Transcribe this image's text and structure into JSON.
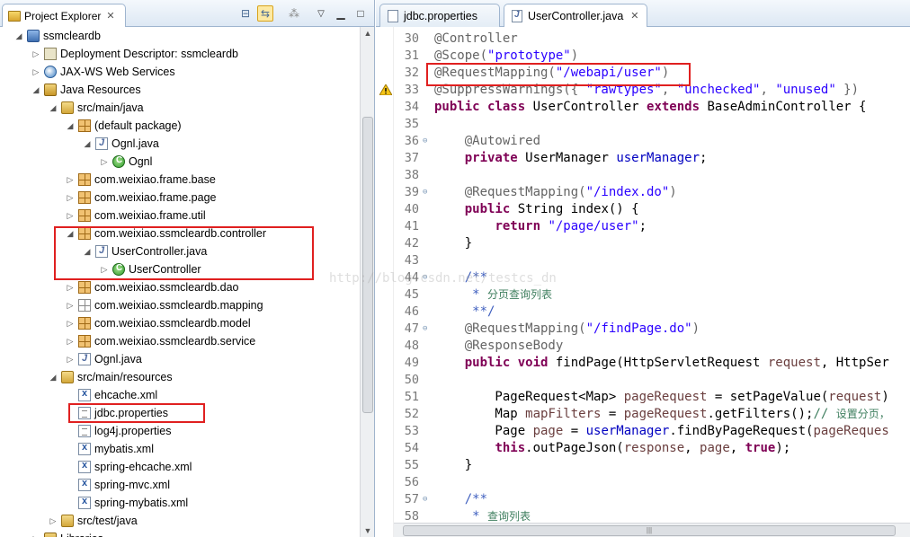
{
  "explorer": {
    "tab_label": "Project Explorer",
    "tree": [
      {
        "label": "ssmcleardb",
        "icon": "project",
        "indent": 0,
        "twisty": "open"
      },
      {
        "label": "Deployment Descriptor: ssmcleardb",
        "icon": "dd",
        "indent": 1,
        "twisty": "closed"
      },
      {
        "label": "JAX-WS Web Services",
        "icon": "ws",
        "indent": 1,
        "twisty": "closed"
      },
      {
        "label": "Java Resources",
        "icon": "jr",
        "indent": 1,
        "twisty": "open"
      },
      {
        "label": "src/main/java",
        "icon": "srcfolder",
        "indent": 2,
        "twisty": "open"
      },
      {
        "label": "(default package)",
        "icon": "pkg",
        "indent": 3,
        "twisty": "open"
      },
      {
        "label": "Ognl.java",
        "icon": "jfile",
        "indent": 4,
        "twisty": "open"
      },
      {
        "label": "Ognl",
        "icon": "cls",
        "indent": 5,
        "twisty": "closed"
      },
      {
        "label": "com.weixiao.frame.base",
        "icon": "pkg",
        "indent": 3,
        "twisty": "closed"
      },
      {
        "label": "com.weixiao.frame.page",
        "icon": "pkg",
        "indent": 3,
        "twisty": "closed"
      },
      {
        "label": "com.weixiao.frame.util",
        "icon": "pkg",
        "indent": 3,
        "twisty": "closed"
      },
      {
        "label": "com.weixiao.ssmcleardb.controller",
        "icon": "pkg",
        "indent": 3,
        "twisty": "open"
      },
      {
        "label": "UserController.java",
        "icon": "jfile",
        "indent": 4,
        "twisty": "open"
      },
      {
        "label": "UserController",
        "icon": "cls",
        "indent": 5,
        "twisty": "closed"
      },
      {
        "label": "com.weixiao.ssmcleardb.dao",
        "icon": "pkg",
        "indent": 3,
        "twisty": "closed"
      },
      {
        "label": "com.weixiao.ssmcleardb.mapping",
        "icon": "pkg-empty",
        "indent": 3,
        "twisty": "closed"
      },
      {
        "label": "com.weixiao.ssmcleardb.model",
        "icon": "pkg",
        "indent": 3,
        "twisty": "closed"
      },
      {
        "label": "com.weixiao.ssmcleardb.service",
        "icon": "pkg",
        "indent": 3,
        "twisty": "closed"
      },
      {
        "label": "Ognl.java",
        "icon": "jfile",
        "indent": 3,
        "twisty": "closed"
      },
      {
        "label": "src/main/resources",
        "icon": "srcfolder",
        "indent": 2,
        "twisty": "open"
      },
      {
        "label": "ehcache.xml",
        "icon": "xml",
        "indent": 3,
        "twisty": "none"
      },
      {
        "label": "jdbc.properties",
        "icon": "props",
        "indent": 3,
        "twisty": "none"
      },
      {
        "label": "log4j.properties",
        "icon": "props",
        "indent": 3,
        "twisty": "none"
      },
      {
        "label": "mybatis.xml",
        "icon": "xml",
        "indent": 3,
        "twisty": "none"
      },
      {
        "label": "spring-ehcache.xml",
        "icon": "xml",
        "indent": 3,
        "twisty": "none"
      },
      {
        "label": "spring-mvc.xml",
        "icon": "xml",
        "indent": 3,
        "twisty": "none"
      },
      {
        "label": "spring-mybatis.xml",
        "icon": "xml",
        "indent": 3,
        "twisty": "none"
      },
      {
        "label": "src/test/java",
        "icon": "srcfolder",
        "indent": 2,
        "twisty": "closed"
      },
      {
        "label": "Libraries",
        "icon": "jr",
        "indent": 1,
        "twisty": "closed"
      }
    ]
  },
  "editor": {
    "tabs": [
      {
        "label": "jdbc.properties",
        "active": false
      },
      {
        "label": "UserController.java",
        "active": true
      }
    ],
    "lines": [
      {
        "n": "30",
        "fold": "",
        "warn": false,
        "tokens": [
          [
            "ann",
            "@Controller"
          ]
        ]
      },
      {
        "n": "31",
        "fold": "",
        "warn": false,
        "tokens": [
          [
            "ann",
            "@Scope("
          ],
          [
            "str",
            "\"prototype\""
          ],
          [
            "ann",
            ")"
          ]
        ]
      },
      {
        "n": "32",
        "fold": "",
        "warn": false,
        "tokens": [
          [
            "ann",
            "@RequestMapping("
          ],
          [
            "str",
            "\"/webapi/user\""
          ],
          [
            "ann",
            ")"
          ]
        ]
      },
      {
        "n": "33",
        "fold": "",
        "warn": true,
        "tokens": [
          [
            "ann",
            "@SuppressWarnings({ "
          ],
          [
            "str",
            "\"rawtypes\""
          ],
          [
            "ann",
            ", "
          ],
          [
            "str",
            "\"unchecked\""
          ],
          [
            "ann",
            ", "
          ],
          [
            "str",
            "\"unused\""
          ],
          [
            "ann",
            " })"
          ]
        ]
      },
      {
        "n": "34",
        "fold": "",
        "warn": false,
        "tokens": [
          [
            "kw",
            "public class"
          ],
          [
            "ctext",
            " UserController "
          ],
          [
            "kw",
            "extends"
          ],
          [
            "ctext",
            " BaseAdminController {"
          ]
        ]
      },
      {
        "n": "35",
        "fold": "",
        "warn": false,
        "tokens": []
      },
      {
        "n": "36",
        "fold": "⊖",
        "warn": false,
        "tokens": [
          [
            "ctext",
            "    "
          ],
          [
            "ann",
            "@Autowired"
          ]
        ]
      },
      {
        "n": "37",
        "fold": "",
        "warn": false,
        "tokens": [
          [
            "ctext",
            "    "
          ],
          [
            "kw",
            "private"
          ],
          [
            "ctext",
            " UserManager "
          ],
          [
            "fld",
            "userManager"
          ],
          [
            "ctext",
            ";"
          ]
        ]
      },
      {
        "n": "38",
        "fold": "",
        "warn": false,
        "tokens": []
      },
      {
        "n": "39",
        "fold": "⊖",
        "warn": false,
        "tokens": [
          [
            "ctext",
            "    "
          ],
          [
            "ann",
            "@RequestMapping("
          ],
          [
            "str",
            "\"/index.do\""
          ],
          [
            "ann",
            ")"
          ]
        ]
      },
      {
        "n": "40",
        "fold": "",
        "warn": false,
        "tokens": [
          [
            "ctext",
            "    "
          ],
          [
            "kw",
            "public"
          ],
          [
            "ctext",
            " String index() {"
          ]
        ]
      },
      {
        "n": "41",
        "fold": "",
        "warn": false,
        "tokens": [
          [
            "ctext",
            "        "
          ],
          [
            "kw",
            "return"
          ],
          [
            "ctext",
            " "
          ],
          [
            "str",
            "\"/page/user\""
          ],
          [
            "ctext",
            ";"
          ]
        ]
      },
      {
        "n": "42",
        "fold": "",
        "warn": false,
        "tokens": [
          [
            "ctext",
            "    }"
          ]
        ]
      },
      {
        "n": "43",
        "fold": "",
        "warn": false,
        "tokens": []
      },
      {
        "n": "44",
        "fold": "⊖",
        "warn": false,
        "tokens": [
          [
            "ctext",
            "    "
          ],
          [
            "jdoc",
            "/**"
          ]
        ]
      },
      {
        "n": "45",
        "fold": "",
        "warn": false,
        "tokens": [
          [
            "ctext",
            "     "
          ],
          [
            "jdoc",
            "* "
          ],
          [
            "cn",
            "分页查询列表"
          ]
        ]
      },
      {
        "n": "46",
        "fold": "",
        "warn": false,
        "tokens": [
          [
            "ctext",
            "     "
          ],
          [
            "jdoc",
            "**/"
          ]
        ]
      },
      {
        "n": "47",
        "fold": "⊖",
        "warn": false,
        "tokens": [
          [
            "ctext",
            "    "
          ],
          [
            "ann",
            "@RequestMapping("
          ],
          [
            "str",
            "\"/findPage.do\""
          ],
          [
            "ann",
            ")"
          ]
        ]
      },
      {
        "n": "48",
        "fold": "",
        "warn": false,
        "tokens": [
          [
            "ctext",
            "    "
          ],
          [
            "ann",
            "@ResponseBody"
          ]
        ]
      },
      {
        "n": "49",
        "fold": "",
        "warn": false,
        "tokens": [
          [
            "ctext",
            "    "
          ],
          [
            "kw",
            "public void"
          ],
          [
            "ctext",
            " findPage(HttpServletRequest "
          ],
          [
            "var",
            "request"
          ],
          [
            "ctext",
            ", HttpSer"
          ]
        ]
      },
      {
        "n": "50",
        "fold": "",
        "warn": false,
        "tokens": []
      },
      {
        "n": "51",
        "fold": "",
        "warn": false,
        "tokens": [
          [
            "ctext",
            "        PageRequest<Map> "
          ],
          [
            "var",
            "pageRequest"
          ],
          [
            "ctext",
            " = setPageValue("
          ],
          [
            "var",
            "request"
          ],
          [
            "ctext",
            ")"
          ]
        ]
      },
      {
        "n": "52",
        "fold": "",
        "warn": false,
        "tokens": [
          [
            "ctext",
            "        Map "
          ],
          [
            "var",
            "mapFilters"
          ],
          [
            "ctext",
            " = "
          ],
          [
            "var",
            "pageRequest"
          ],
          [
            "ctext",
            ".getFilters();"
          ],
          [
            "cmt",
            "// "
          ],
          [
            "cn",
            "设置分页，"
          ]
        ]
      },
      {
        "n": "53",
        "fold": "",
        "warn": false,
        "tokens": [
          [
            "ctext",
            "        Page "
          ],
          [
            "var",
            "page"
          ],
          [
            "ctext",
            " = "
          ],
          [
            "fld",
            "userManager"
          ],
          [
            "ctext",
            ".findByPageRequest("
          ],
          [
            "var",
            "pageReques"
          ]
        ]
      },
      {
        "n": "54",
        "fold": "",
        "warn": false,
        "tokens": [
          [
            "ctext",
            "        "
          ],
          [
            "kw",
            "this"
          ],
          [
            "ctext",
            ".outPageJson("
          ],
          [
            "var",
            "response"
          ],
          [
            "ctext",
            ", "
          ],
          [
            "var",
            "page"
          ],
          [
            "ctext",
            ", "
          ],
          [
            "kw",
            "true"
          ],
          [
            "ctext",
            ");"
          ]
        ]
      },
      {
        "n": "55",
        "fold": "",
        "warn": false,
        "tokens": [
          [
            "ctext",
            "    }"
          ]
        ]
      },
      {
        "n": "56",
        "fold": "",
        "warn": false,
        "tokens": []
      },
      {
        "n": "57",
        "fold": "⊖",
        "warn": false,
        "tokens": [
          [
            "ctext",
            "    "
          ],
          [
            "jdoc",
            "/**"
          ]
        ]
      },
      {
        "n": "58",
        "fold": "",
        "warn": false,
        "tokens": [
          [
            "ctext",
            "     "
          ],
          [
            "jdoc",
            "* "
          ],
          [
            "cn",
            "查询列表"
          ]
        ]
      }
    ]
  },
  "watermark": "http://blog.csdn.net/testcs_dn",
  "colors": {
    "highlight_box": "#e02020",
    "keyword": "#7f0055",
    "string": "#2a00ff",
    "annotation": "#646464"
  }
}
